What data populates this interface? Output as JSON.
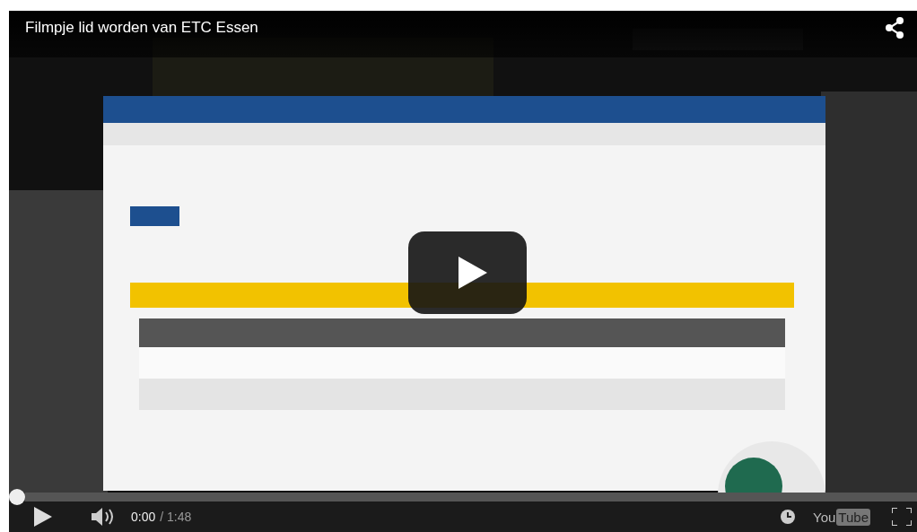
{
  "title": "Filmpje lid worden van ETC Essen",
  "progress": {
    "level": 0
  },
  "time": {
    "current": "0:00",
    "total": "/ 1:48"
  },
  "logo": {
    "part_1": "You",
    "part_2": "Tube"
  }
}
